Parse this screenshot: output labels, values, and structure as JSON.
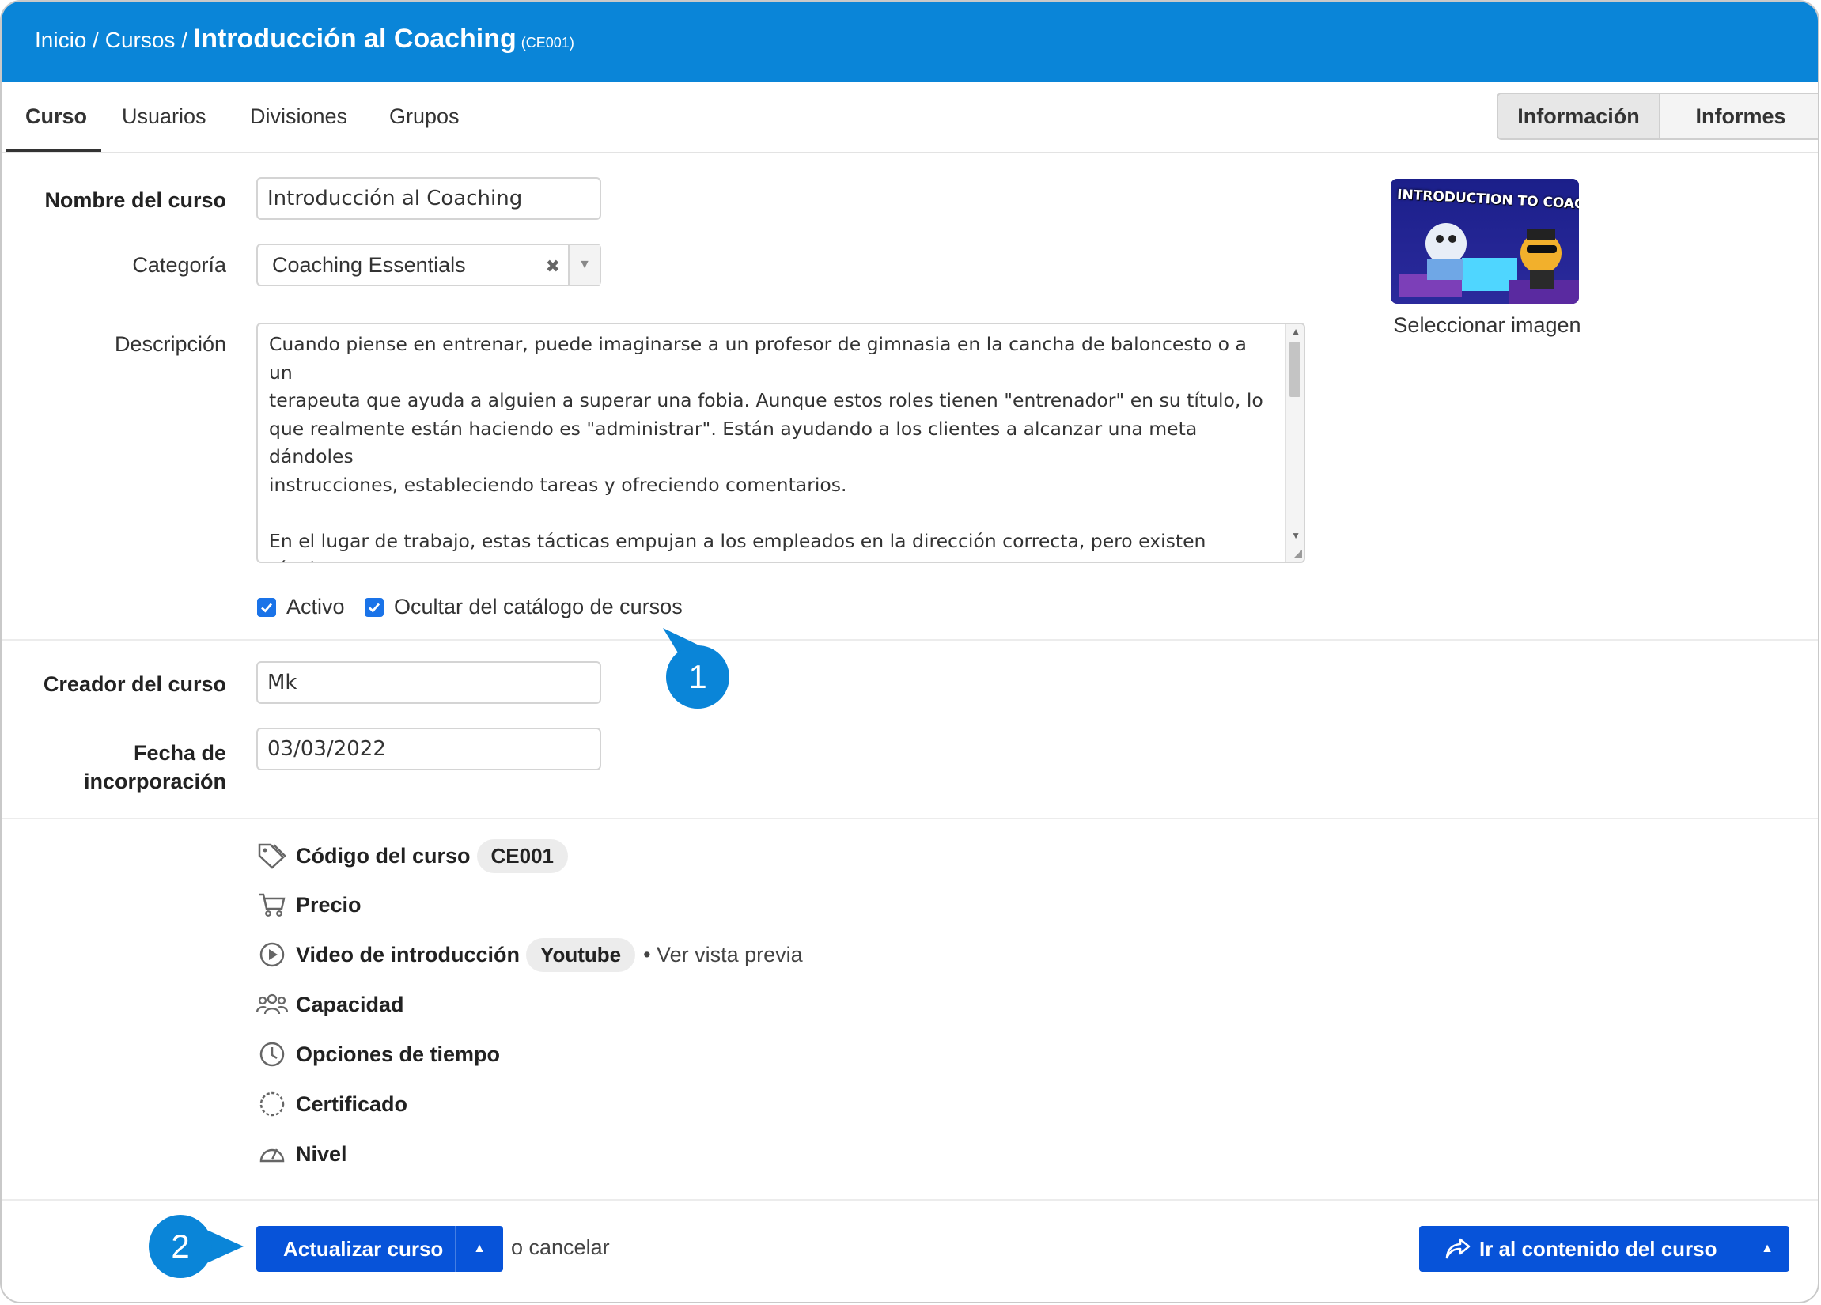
{
  "header": {
    "breadcrumb_home": "Inicio",
    "breadcrumb_sep": "/",
    "breadcrumb_courses": "Cursos",
    "title": "Introducción al Coaching",
    "code": "(CE001)",
    "bg_color": "#0a85d8"
  },
  "tabs": [
    {
      "label": "Curso",
      "active": true
    },
    {
      "label": "Usuarios"
    },
    {
      "label": "Divisiones"
    },
    {
      "label": "Grupos"
    }
  ],
  "view_toggle": {
    "info": "Información",
    "reports": "Informes",
    "active": "Información"
  },
  "form": {
    "name_label": "Nombre del curso",
    "name_value": "Introducción al Coaching",
    "category_label": "Categoría",
    "category_value": "Coaching Essentials",
    "description_label": "Descripción",
    "description_value": "Cuando piense en entrenar, puede imaginarse a un profesor de gimnasia en la cancha de baloncesto o a un\nterapeuta que ayuda a alguien a superar una fobia. Aunque estos roles tienen \"entrenador\" en su título, lo\nque realmente están haciendo es \"administrar\". Están ayudando a los clientes a alcanzar una meta dándoles\ninstrucciones, estableciendo tareas y ofreciendo comentarios.\n\nEn el lugar de trabajo, estas tácticas empujan a los empleados en la dirección correcta, pero existen técnicas\nmás eficientes que puede usar para desarrollar sus habilidades de pensamiento. Entrenar a los empleados\ndifiere de otros comportamientos gerenciales. Se trata de maximizar el potencial del personal alentándolos a",
    "active_label": "Activo",
    "active_checked": true,
    "hide_catalog_label": "Ocultar del catálogo de cursos",
    "hide_catalog_checked": true,
    "creator_label": "Creador del curso",
    "creator_value": "Mk",
    "date_label_line1": "Fecha de",
    "date_label_line2": "incorporación",
    "date_value": "03/03/2022"
  },
  "image": {
    "caption": "Seleccionar imagen",
    "thumb_text": "INTRODUCTION TO COACHING"
  },
  "info": {
    "code_label": "Código del curso",
    "code_value": "CE001",
    "price_label": "Precio",
    "video_label": "Video de introducción",
    "video_value": "Youtube",
    "video_preview": "• Ver vista previa",
    "capacity_label": "Capacidad",
    "time_label": "Opciones de tiempo",
    "cert_label": "Certificado",
    "level_label": "Nivel"
  },
  "callouts": {
    "one": "1",
    "two": "2"
  },
  "actions": {
    "update": "Actualizar curso",
    "cancel": "o cancelar",
    "goto": "Ir al contenido del curso",
    "primary_color": "#0753d9"
  }
}
